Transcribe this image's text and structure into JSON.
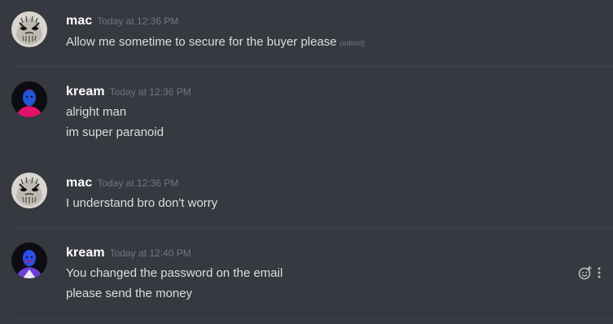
{
  "colors": {
    "background": "#36393f",
    "username": "#ffffff",
    "timestamp": "#72767d",
    "message_text": "#dcddde",
    "divider": "#40434a"
  },
  "messages": [
    {
      "username": "mac",
      "timestamp": "Today at 12:36 PM",
      "avatar_icon": "mac-avatar",
      "lines": [
        "Allow me sometime to secure for the buyer please"
      ],
      "edited_label": "(edited)"
    },
    {
      "username": "kream",
      "timestamp": "Today at 12:36 PM",
      "avatar_icon": "kream-avatar-pink",
      "lines": [
        "alright man",
        "im super paranoid"
      ]
    },
    {
      "username": "mac",
      "timestamp": "Today at 12:36 PM",
      "avatar_icon": "mac-avatar",
      "lines": [
        "I understand bro don't worry"
      ]
    },
    {
      "username": "kream",
      "timestamp": "Today at 12:40 PM",
      "avatar_icon": "kream-avatar-purple",
      "lines": [
        "You changed the password on the email",
        "please send the money"
      ],
      "actions": [
        "add-reaction-icon",
        "more-options-icon"
      ]
    }
  ]
}
